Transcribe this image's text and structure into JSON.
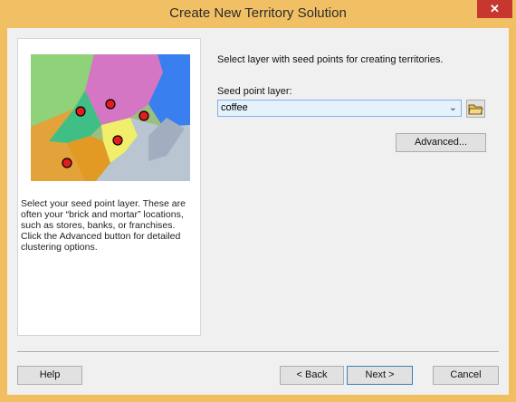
{
  "window": {
    "title": "Create New Territory Solution",
    "close_label": "✕"
  },
  "left_panel": {
    "map_image": "territory-map-with-seed-points",
    "description": "Select your seed point layer. These are often your “brick and mortar” locations, such as stores, banks, or franchises. Click the Advanced button for detailed clustering options."
  },
  "main": {
    "prompt": "Select layer with seed points for creating territories.",
    "seed_label": "Seed point layer:",
    "seed_value": "coffee",
    "advanced_label": "Advanced..."
  },
  "footer": {
    "help_label": "Help",
    "back_label": "< Back",
    "next_label": "Next >",
    "cancel_label": "Cancel"
  },
  "icons": {
    "dropdown": "chevron-down-icon",
    "browse": "open-folder-icon"
  }
}
